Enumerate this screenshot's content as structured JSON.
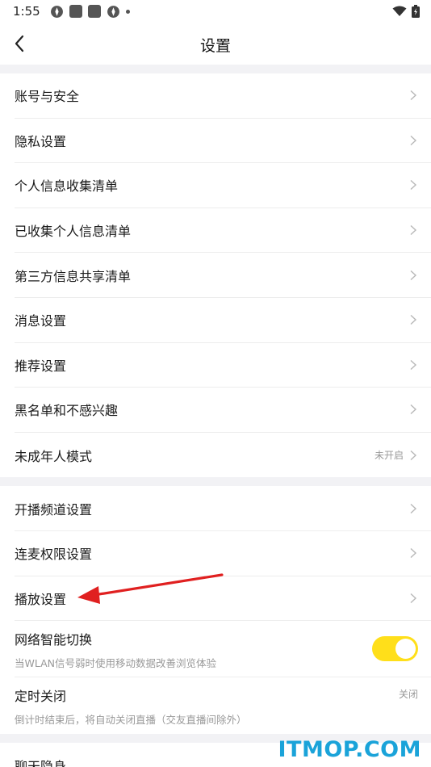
{
  "status_bar": {
    "time": "1:55"
  },
  "nav": {
    "title": "设置"
  },
  "sections": [
    {
      "items": [
        {
          "label": "账号与安全"
        },
        {
          "label": "隐私设置"
        },
        {
          "label": "个人信息收集清单"
        },
        {
          "label": "已收集个人信息清单"
        },
        {
          "label": "第三方信息共享清单"
        },
        {
          "label": "消息设置"
        },
        {
          "label": "推荐设置"
        },
        {
          "label": "黑名单和不感兴趣"
        },
        {
          "label": "未成年人模式",
          "value": "未开启"
        }
      ]
    },
    {
      "items": [
        {
          "label": "开播频道设置"
        },
        {
          "label": "连麦权限设置"
        },
        {
          "label": "播放设置"
        },
        {
          "label": "网络智能切换",
          "subtitle": "当WLAN信号弱时使用移动数据改善浏览体验",
          "toggle_on": true
        },
        {
          "label": "定时关闭",
          "subtitle": "倒计时结束后，将自动关闭直播（交友直播间除外）",
          "value": "关闭"
        }
      ]
    },
    {
      "items": [
        {
          "label": "聊天隐身"
        }
      ]
    }
  ],
  "colors": {
    "toggle_on": "#ffdf1a",
    "annotation_arrow": "#e02020",
    "watermark": "#1aa3d9",
    "section_gap": "#f2f2f5"
  },
  "watermark": "ITMOP.COM"
}
